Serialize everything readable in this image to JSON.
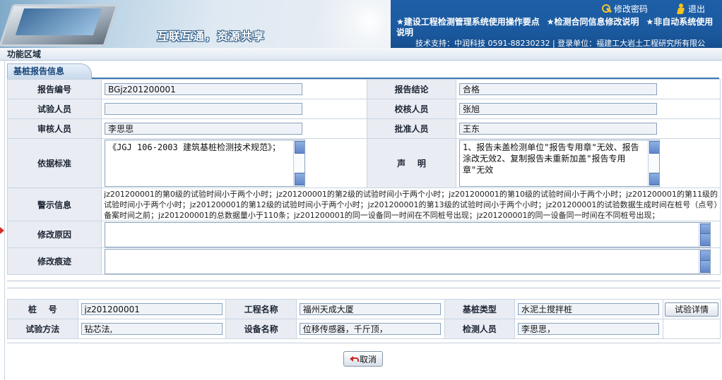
{
  "header": {
    "slogan": "互联互通，资源共享",
    "change_password": "修改密码",
    "logout": "退出",
    "notices": [
      "★建设工程检测管理系统使用操作要点",
      "★检测合同信息修改说明",
      "★非自动系统使用说明"
    ],
    "support_text": "技术支持：中润科技  0591-88230232 | 登录单位：福建工大岩土工程研究所有限公"
  },
  "func_area": {
    "title": "功能区域"
  },
  "tab": {
    "label": "基桩报告信息"
  },
  "form": {
    "report_no_label": "报告编号",
    "report_no": "BGjz201200001",
    "conclusion_label": "报告结论",
    "conclusion": "合格",
    "tester_label": "试验人员",
    "tester": "",
    "checker_label": "校核人员",
    "checker": "张旭",
    "reviewer_label": "审核人员",
    "reviewer": "李思思",
    "approver_label": "批准人员",
    "approver": "王东",
    "standard_label": "依据标准",
    "standard": "《JGJ 106-2003 建筑基桩检测技术规范》；",
    "statement_label": "声    明",
    "statement": "1、报告未盖检测单位\"报告专用章\"无效、报告涂改无效2、复制报告未重新加盖\"报告专用章\"无效",
    "warning_label": "警示信息",
    "warning": "jz201200001的第0级的试验时间小于两个小时；jz201200001的第2级的试验时间小于两个小时；jz201200001的第10级的试验时间小于两个小时；jz201200001的第11级的试验时间小于两个小时；jz201200001的第12级的试验时间小于两个小时；jz201200001的第13级的试验时间小于两个小时；jz201200001的试验数据生成时间在桩号（点号）备案时间之前；jz201200001的总数据量小于110条；jz201200001的同一设备同一时间在不同桩号出现；jz201200001的同一设备同一时间在不同桩号出现；",
    "reason_label": "修改原因",
    "reason": "",
    "trace_label": "修改痕迹",
    "trace": ""
  },
  "pile": {
    "pile_no_label": "桩    号",
    "pile_no": "jz201200001",
    "project_label": "工程名称",
    "project": "福州天成大厦",
    "pile_type_label": "基桩类型",
    "pile_type": "水泥土搅拌桩",
    "detail_button": "试验详情",
    "method_label": "试验方法",
    "method": "钻芯法,",
    "device_label": "设备名称",
    "device": "位移传感器，千斤顶，",
    "inspector_label": "检测人员",
    "inspector": "李思思，"
  },
  "actions": {
    "cancel": "取消"
  },
  "icons": [
    "key-icon",
    "exit-icon",
    "back-arrow-icon"
  ],
  "colors": {
    "top_bar": "#1d5fa7",
    "label_bg": "#e9edf3",
    "tab_border": "#3f78b5"
  }
}
